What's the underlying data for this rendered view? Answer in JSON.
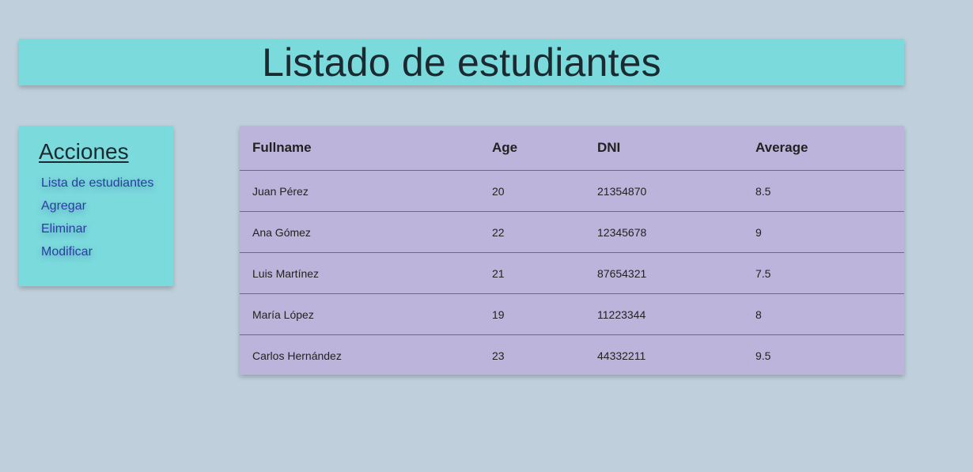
{
  "header": {
    "title": "Listado de estudiantes"
  },
  "sidebar": {
    "title": "Acciones",
    "items": [
      {
        "label": "Lista de estudiantes"
      },
      {
        "label": "Agregar"
      },
      {
        "label": "Eliminar"
      },
      {
        "label": "Modificar"
      }
    ]
  },
  "table": {
    "columns": [
      "Fullname",
      "Age",
      "DNI",
      "Average"
    ],
    "rows": [
      [
        "Juan Pérez",
        "20",
        "21354870",
        "8.5"
      ],
      [
        "Ana Gómez",
        "22",
        "12345678",
        "9"
      ],
      [
        "Luis Martínez",
        "21",
        "87654321",
        "7.5"
      ],
      [
        "María López",
        "19",
        "11223344",
        "8"
      ],
      [
        "Carlos Hernández",
        "23",
        "44332211",
        "9.5"
      ]
    ]
  },
  "colors": {
    "background": "#bfd0dc",
    "panel": "#7bdadc",
    "table": "#bcb4da",
    "link": "#2b3ea0"
  }
}
